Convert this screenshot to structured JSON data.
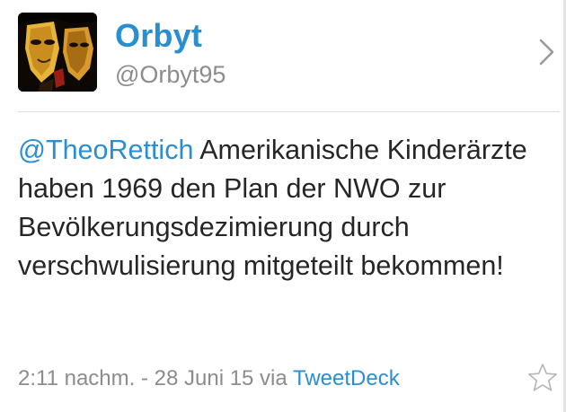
{
  "profile": {
    "display_name": "Orbyt",
    "handle": "@Orbyt95"
  },
  "tweet": {
    "mention": "@TheoRettich",
    "text": " Amerikanische Kinderärzte haben 1969 den Plan der NWO zur Bevölkerungsdezimierung durch verschwulisierung mitgeteilt bekommen!"
  },
  "meta": {
    "timestamp": "2:11 nachm. - 28 Juni 15",
    "via": " via ",
    "source": "TweetDeck"
  },
  "icons": {
    "chevron": "chevron-right-icon",
    "favorite": "star-outline-icon"
  },
  "colors": {
    "accent": "#2a8fd0",
    "secondary_text": "#8c8c8c",
    "body_text": "#262626"
  }
}
